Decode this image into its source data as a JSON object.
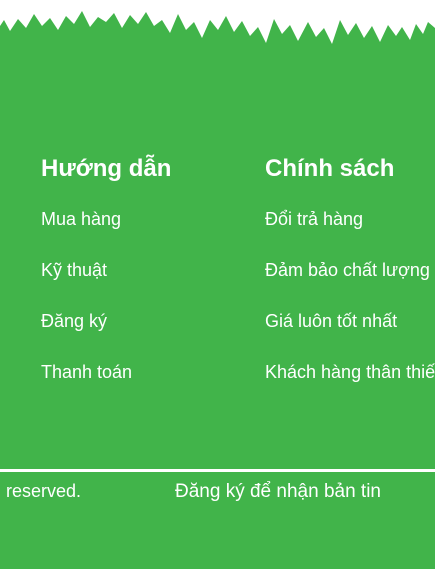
{
  "colors": {
    "background": "#41b44a",
    "text": "#ffffff"
  },
  "guide": {
    "heading": "Hướng dẫn",
    "links": [
      "Mua hàng",
      "Kỹ thuật",
      "Đăng ký",
      "Thanh toán"
    ]
  },
  "policy": {
    "heading": "Chính sách",
    "links": [
      "Đổi trả hàng",
      "Đảm bảo chất lượng",
      "Giá luôn tốt nhất",
      "Khách hàng thân thiết"
    ]
  },
  "bottom": {
    "copyright": "reserved.",
    "newsletter": "Đăng ký để nhận bản tin"
  }
}
